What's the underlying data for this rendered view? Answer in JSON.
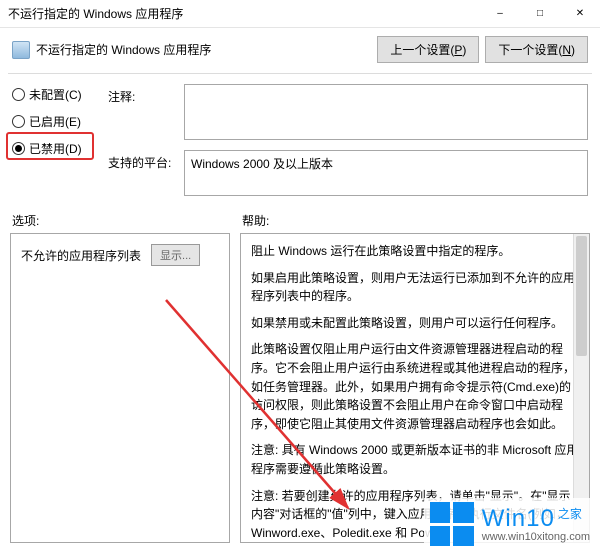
{
  "titlebar": {
    "title": "不运行指定的 Windows 应用程序"
  },
  "header": {
    "title": "不运行指定的 Windows 应用程序",
    "prev": "上一个设置(",
    "prev_accel": "P",
    "prev_close": ")",
    "next": "下一个设置(",
    "next_accel": "N",
    "next_close": ")"
  },
  "radios": {
    "not_configured": "未配置(",
    "nc_accel": "C",
    "nc_close": ")",
    "enabled": "已启用(",
    "en_accel": "E",
    "en_close": ")",
    "disabled": "已禁用(",
    "dis_accel": "D",
    "dis_close": ")"
  },
  "fields": {
    "comment_label": "注释:",
    "comment_value": "",
    "platform_label": "支持的平台:",
    "platform_value": "Windows 2000 及以上版本"
  },
  "sections": {
    "options_label": "选项:",
    "help_label": "帮助:"
  },
  "options": {
    "list_label": "不允许的应用程序列表",
    "show_btn": "显示..."
  },
  "help": {
    "p1": "阻止 Windows 运行在此策略设置中指定的程序。",
    "p2": "如果启用此策略设置，则用户无法运行已添加到不允许的应用程序列表中的程序。",
    "p3": "如果禁用或未配置此策略设置，则用户可以运行任何程序。",
    "p4": "此策略设置仅阻止用户运行由文件资源管理器进程启动的程序。它不会阻止用户运行由系统进程或其他进程启动的程序，如任务管理器。此外，如果用户拥有命令提示符(Cmd.exe)的访问权限，则此策略设置不会阻止用户在命令窗口中启动程序，即使它阻止其使用文件资源管理器启动程序也会如此。",
    "p5": "注意: 具有 Windows 2000 或更新版本证书的非 Microsoft 应用程序需要遵循此策略设置。",
    "p6": "注意: 若要创建允许的应用程序列表，请单击\"显示\"。在\"显示内容\"对话框的\"值\"列中，键入应用程序可执行文件名(例如，Winword.exe、Poledit.exe 和 Power"
  },
  "watermark": {
    "brand_main": "Win10",
    "brand_sup": "之家",
    "url": "www.win10xitong.com"
  }
}
